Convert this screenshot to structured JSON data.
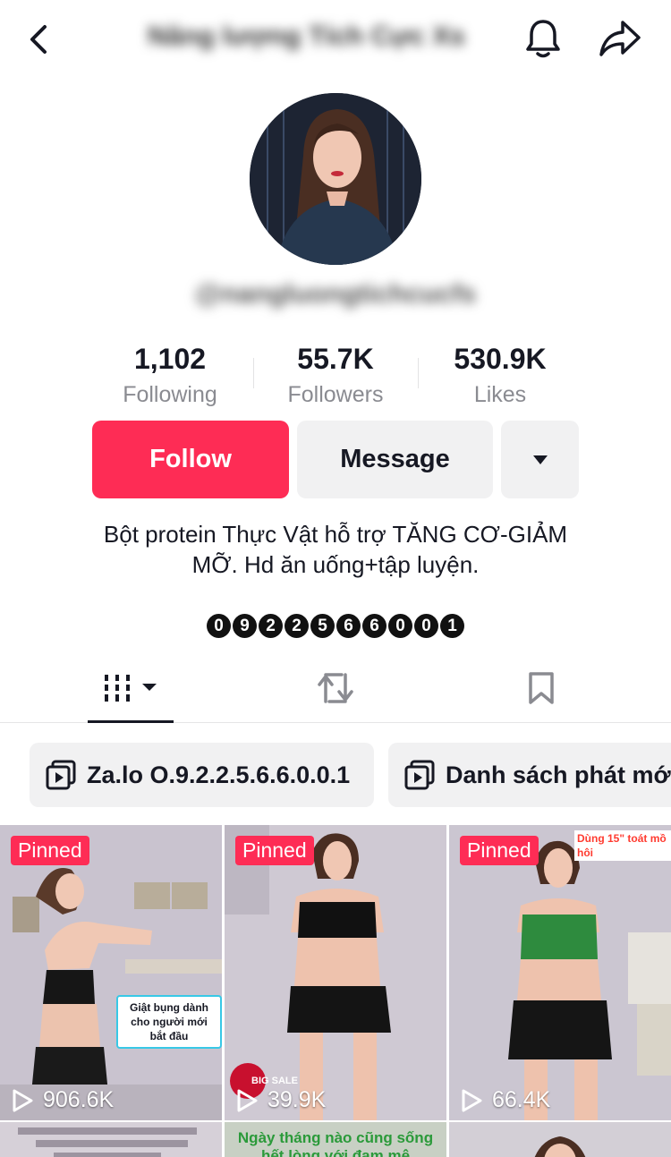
{
  "header": {
    "title": "Năng lượng Tích Cực Xs",
    "back_icon": "chevron-left-icon",
    "bell_icon": "bell-icon",
    "share_icon": "share-arrow-icon"
  },
  "profile": {
    "handle": "@nangluongtichcucfs"
  },
  "stats": {
    "following": {
      "value": "1,102",
      "label": "Following"
    },
    "followers": {
      "value": "55.7K",
      "label": "Followers"
    },
    "likes": {
      "value": "530.9K",
      "label": "Likes"
    }
  },
  "buttons": {
    "follow": "Follow",
    "message": "Message",
    "more_icon": "caret-down-icon"
  },
  "bio": {
    "line1": "Bột protein Thực Vật hỗ trợ TĂNG CƠ-GIẢM",
    "line2": "MỠ. Hd ăn uống+tập luyện.",
    "phone_digits": [
      "0",
      "9",
      "2",
      "2",
      "5",
      "6",
      "6",
      "0",
      "0",
      "1"
    ]
  },
  "tabs": {
    "videos_icon": "grid-bars-icon",
    "repost_icon": "repost-icon",
    "saved_icon": "bookmark-icon"
  },
  "playlists": [
    {
      "label": "Za.lo O.9.2.2.5.6.6.0.0.1"
    },
    {
      "label": "Danh sách phát mới"
    }
  ],
  "videos": [
    {
      "pinned": "Pinned",
      "views": "906.6K",
      "caption": "Giật bụng dành cho người mới bắt đầu"
    },
    {
      "pinned": "Pinned",
      "views": "39.9K",
      "caption": "BIG SALE"
    },
    {
      "pinned": "Pinned",
      "views": "66.4K",
      "caption": "Dùng 15\" toát mồ hôi"
    }
  ],
  "row2_captions": [
    "Ngày tháng nào cũng sống hết lòng với đam mê"
  ],
  "colors": {
    "accent": "#fe2c55",
    "secondary_bg": "#f1f1f2",
    "muted_text": "#8a8b91"
  }
}
